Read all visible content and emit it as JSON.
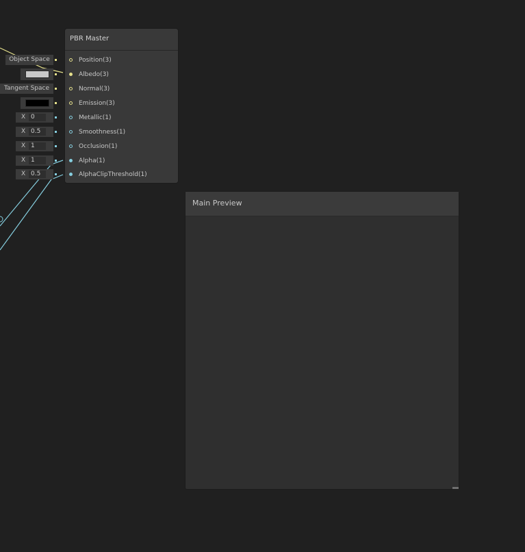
{
  "node": {
    "title": "PBR Master",
    "ports": [
      {
        "label": "Position(3)",
        "type": "vector3",
        "input": {
          "kind": "text",
          "value": "Object Space"
        }
      },
      {
        "label": "Albedo(3)",
        "type": "vector3",
        "input": {
          "kind": "color",
          "color": "#c8c8c8"
        }
      },
      {
        "label": "Normal(3)",
        "type": "vector3",
        "input": {
          "kind": "text",
          "value": "Tangent Space"
        }
      },
      {
        "label": "Emission(3)",
        "type": "vector3",
        "input": {
          "kind": "color",
          "color": "#000000"
        }
      },
      {
        "label": "Metallic(1)",
        "type": "vector1",
        "input": {
          "kind": "number",
          "axis": "X",
          "value": "0"
        }
      },
      {
        "label": "Smoothness(1)",
        "type": "vector1",
        "input": {
          "kind": "number",
          "axis": "X",
          "value": "0.5"
        }
      },
      {
        "label": "Occlusion(1)",
        "type": "vector1",
        "input": {
          "kind": "number",
          "axis": "X",
          "value": "1"
        }
      },
      {
        "label": "Alpha(1)",
        "type": "vector1",
        "input": {
          "kind": "number",
          "axis": "X",
          "value": "1"
        }
      },
      {
        "label": "AlphaClipThreshold(1)",
        "type": "vector1",
        "input": {
          "kind": "number",
          "axis": "X",
          "value": "0.5"
        }
      }
    ]
  },
  "preview": {
    "title": "Main Preview"
  },
  "colors": {
    "background": "#202020",
    "vector3_port": "#e5e08c",
    "vector1_port": "#86cfe0"
  }
}
